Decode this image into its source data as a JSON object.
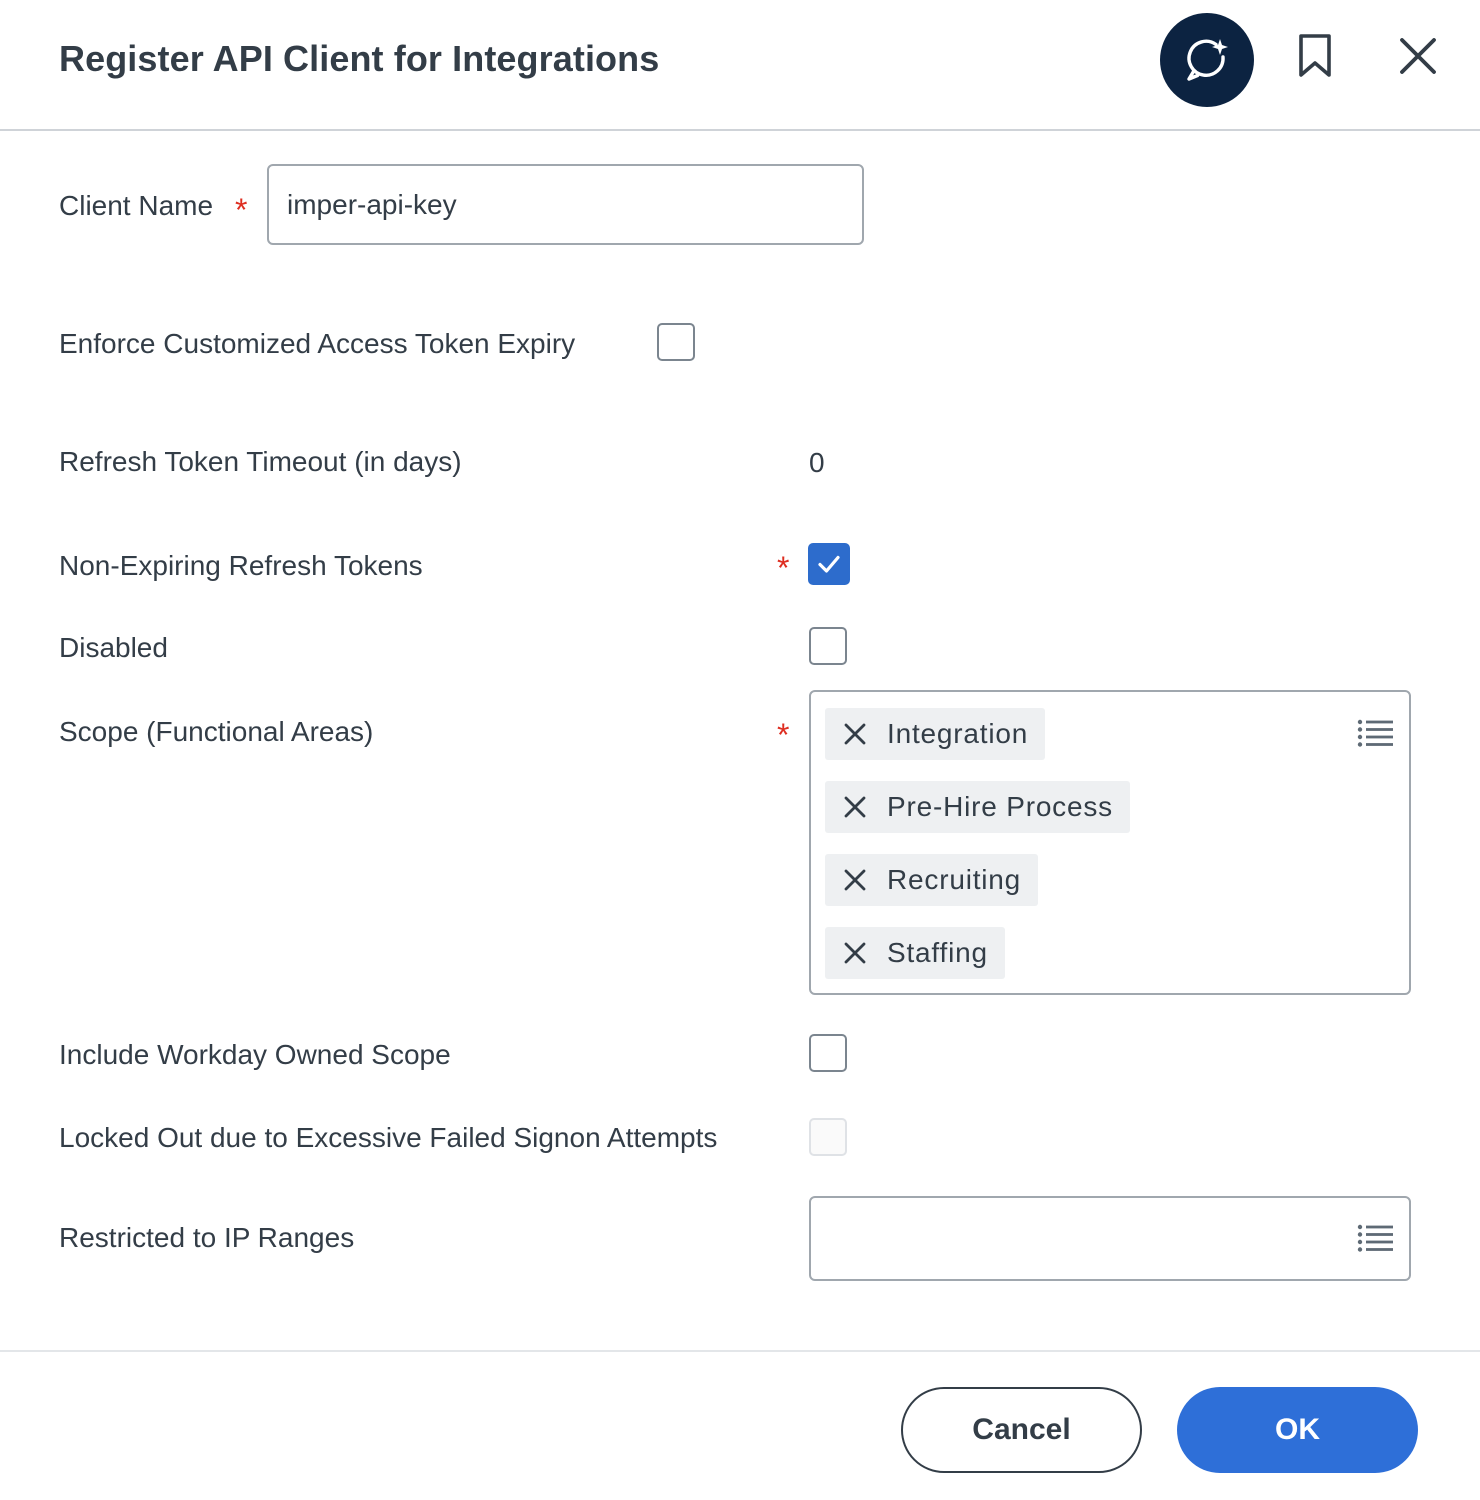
{
  "dialog": {
    "title": "Register API Client for Integrations"
  },
  "header": {
    "icons": [
      "ai-assistant-icon",
      "bookmark-icon",
      "close-icon"
    ]
  },
  "form": {
    "client_name": {
      "label": "Client Name",
      "required_mark": "*",
      "value": "imper-api-key"
    },
    "enforce_expiry": {
      "label": "Enforce Customized Access Token Expiry",
      "checked": false
    },
    "refresh_timeout": {
      "label": "Refresh Token Timeout (in days)",
      "value": "0"
    },
    "non_expiring": {
      "label": "Non-Expiring Refresh Tokens",
      "required_mark": "*",
      "checked": true
    },
    "disabled": {
      "label": "Disabled",
      "checked": false
    },
    "scope": {
      "label": "Scope (Functional Areas)",
      "required_mark": "*",
      "items": [
        "Integration",
        "Pre-Hire Process",
        "Recruiting",
        "Staffing"
      ]
    },
    "workday_owned": {
      "label": "Include Workday Owned Scope",
      "checked": false
    },
    "locked_out": {
      "label": "Locked Out due to Excessive Failed Signon Attempts",
      "checked": false,
      "disabled": true
    },
    "ip_ranges": {
      "label": "Restricted to IP Ranges",
      "value": ""
    }
  },
  "footer": {
    "cancel_label": "Cancel",
    "ok_label": "OK"
  },
  "colors": {
    "primary": "#2e6fd8",
    "checkbox_checked": "#2d6ccc",
    "required": "#de2e21",
    "ai_button": "#0c2341"
  }
}
